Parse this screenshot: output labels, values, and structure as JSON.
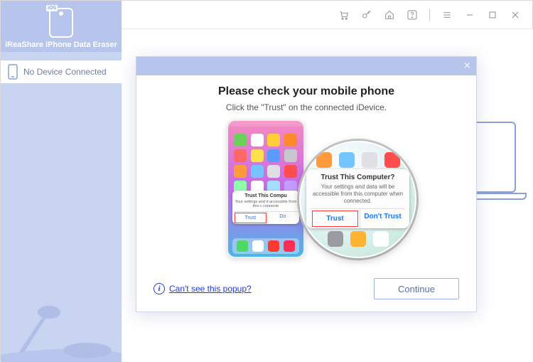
{
  "titlebar": {
    "icons": [
      "cart-icon",
      "key-icon",
      "home-icon",
      "help-icon",
      "menu-icon",
      "minimize-icon",
      "maximize-icon",
      "close-icon"
    ]
  },
  "sidebar": {
    "brand_label": "iReaShare iPhone Data Eraser",
    "device_status": "No Device Connected"
  },
  "dialog": {
    "title": "Please check your mobile phone",
    "subtitle": "Click the \"Trust\" on the connected iDevice.",
    "phone_trust": {
      "title": "Trust This Compu",
      "msg": "Your settings and d\naccessible from this c\nconnecte",
      "trust_label": "Trust",
      "dont_label": "Do"
    },
    "mag_trust": {
      "title": "Trust This Computer?",
      "msg": "Your settings and data will be accessible from this computer when connected.",
      "trust_label": "Trust",
      "dont_label": "Don't Trust"
    },
    "help_link": "Can't see this popup?",
    "continue_label": "Continue"
  }
}
